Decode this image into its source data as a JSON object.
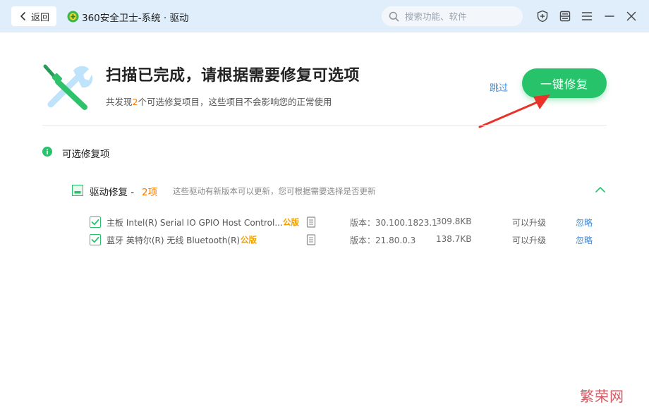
{
  "titlebar": {
    "back_label": "返回",
    "app_title": "360安全卫士-系统 · 驱动",
    "search_placeholder": "搜索功能、软件"
  },
  "header": {
    "title": "扫描已完成，请根据需要修复可选项",
    "subtitle_prefix": "共发现",
    "subtitle_count": "2",
    "subtitle_suffix": "个可选修复项目，这些项目不会影响您的正常使用",
    "skip_label": "跳过",
    "fix_button_label": "一键修复"
  },
  "section": {
    "title": "可选修复项",
    "group": {
      "title": "驱动修复",
      "separator": " - ",
      "count": "2项",
      "description": "这些驱动有新版本可以更新，您可根据需要选择是否更新"
    },
    "items": [
      {
        "name": "主板 Intel(R) Serial IO GPIO Host Control...",
        "badge": "公版",
        "version": "版本：30.100.1823.1",
        "size": "309.8KB",
        "status": "可以升级",
        "action": "忽略"
      },
      {
        "name": "蓝牙 英特尔(R) 无线 Bluetooth(R)",
        "badge": "公版",
        "version": "版本：21.80.0.3",
        "size": "138.7KB",
        "status": "可以升级",
        "action": "忽略"
      }
    ]
  },
  "watermark": "繁荣网",
  "colors": {
    "accent_green": "#26c36a",
    "highlight_orange": "#ff7a00",
    "badge_gold": "#f0a000",
    "link_blue": "#3f8ad8",
    "annotation_red": "#e8322a"
  }
}
